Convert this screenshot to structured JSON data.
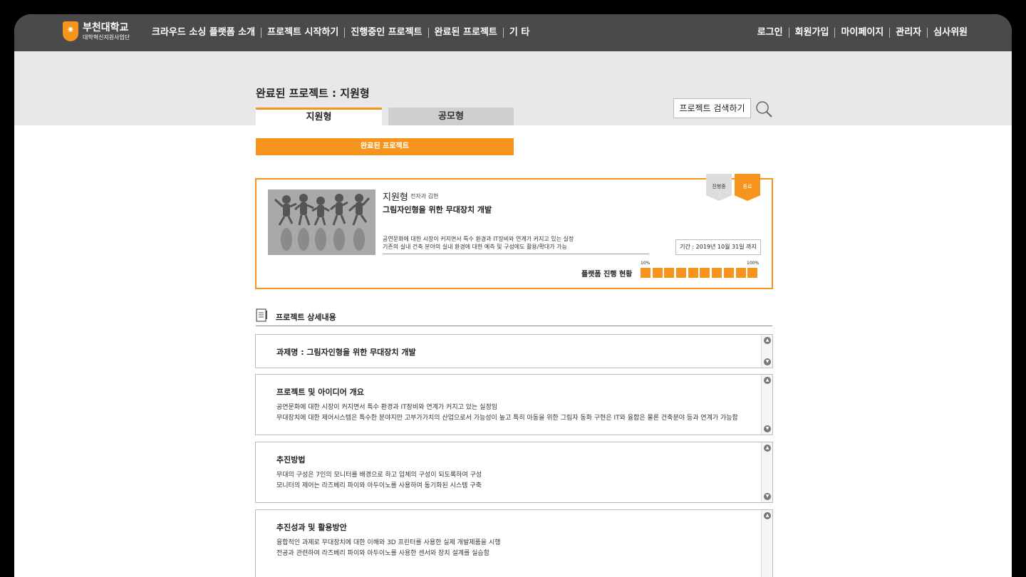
{
  "header": {
    "logo": {
      "name": "부천대학교",
      "sub": "대학혁신지원사업단"
    },
    "nav": [
      "크라우드 소싱 플랫폼 소개",
      "프로젝트 시작하기",
      "진행중인 프로젝트",
      "완료된 프로젝트",
      "기 타"
    ],
    "user_links": [
      "로그인",
      "회원가입",
      "마이페이지",
      "관리자",
      "심사위원"
    ]
  },
  "page": {
    "title": "완료된 프로젝트 : 지원형",
    "tabs": [
      {
        "label": "지원형",
        "active": true
      },
      {
        "label": "공모형",
        "active": false
      }
    ],
    "search_label": "프로젝트 검색하기",
    "section_bar": "완료된 프로젝트"
  },
  "project": {
    "type": "지원형",
    "dept": "전자과 김현",
    "title": "그림자인형을 위한 무대장치 개발",
    "desc_lines": [
      "공연문화에 대한 시장이 커지면서 특수 환경과 IT장비와 연계가 커지고 있는 실정",
      "기존의 실내 건축 분야의 실내 환경에 대한 예측 및 구성에도 활용/확대가 가능"
    ],
    "period": "기간 : 2019년 10월 31일 까지",
    "badges": {
      "in_progress": "진행중",
      "done": "종료"
    },
    "progress_label": "플랫폼 진행 현황",
    "progress_min_label": "10%",
    "progress_max_label": "100%",
    "progress_filled_blocks": 10,
    "progress_total_blocks": 10
  },
  "detail": {
    "heading": "프로젝트 상세내용",
    "boxes": [
      {
        "title": "과제명 : 그림자인형을 위한 무대장치 개발",
        "lines": []
      },
      {
        "title": "프로젝트 및 아이디어 개요",
        "lines": [
          "공연문화에 대한 시장이 커지면서 특수 환경과 IT장비와 연계가 커지고 있는 실정임",
          "무대장치에 대한 제어시스템은 특수한 분야지만 고부가가치의 산업으로서 가능성이 높고 특히 아동을 위한 그림자 동화 구현은 IT와 융합은 물론 건축분야 등과 연계가 가능함"
        ]
      },
      {
        "title": "추진방법",
        "lines": [
          "무대의 구성은 7인의 모니터를 배경으로 하고 입체의 구성이 되도록하여 구성",
          "모니터의 제어는 라즈베리 파이와 아두이노를 사용하여 동기화된 시스템 구축"
        ]
      },
      {
        "title": "추진성과 및 활용방안",
        "lines": [
          "융합적인 과제로 무대장치에 대한 이해와 3D 프린터를 사용한 실제 개발제품을 시행",
          "전공과 관련하여 라즈베리 파이와 아두이노를 사용한 센서와 장치 설계를 실습함"
        ]
      }
    ]
  },
  "colors": {
    "accent": "#f7941d",
    "nav_bg": "#4a4a4a",
    "band_bg": "#e8e8e8"
  }
}
